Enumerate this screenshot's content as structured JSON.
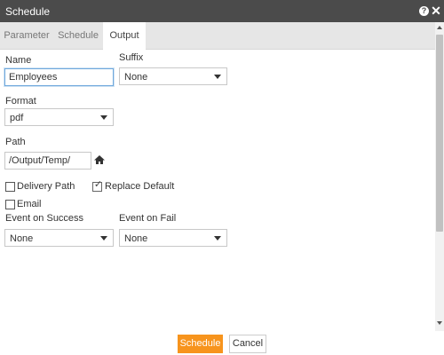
{
  "window": {
    "title": "Schedule",
    "help_glyph": "?",
    "close_glyph": "✕"
  },
  "tabs": [
    {
      "label": "Parameter",
      "active": false
    },
    {
      "label": "Schedule",
      "active": false
    },
    {
      "label": "Output",
      "active": true
    }
  ],
  "form": {
    "name": {
      "label": "Name",
      "value": "Employees"
    },
    "suffix": {
      "label": "Suffix",
      "value": "None"
    },
    "format": {
      "label": "Format",
      "value": "pdf"
    },
    "path": {
      "label": "Path",
      "value": "/Output/Temp/"
    },
    "delivery_path": {
      "label": "Delivery Path",
      "checked": false
    },
    "replace_default": {
      "label": "Replace Default",
      "checked": true,
      "tick": "✓"
    },
    "email": {
      "label": "Email",
      "checked": false
    },
    "event_on_success": {
      "label": "Event on Success",
      "value": "None"
    },
    "event_on_fail": {
      "label": "Event on Fail",
      "value": "None"
    }
  },
  "footer": {
    "schedule_label": "Schedule",
    "cancel_label": "Cancel"
  },
  "colors": {
    "titlebar": "#4b4b4b",
    "accent": "#f7941d",
    "tabbar": "#e6e6e6"
  }
}
